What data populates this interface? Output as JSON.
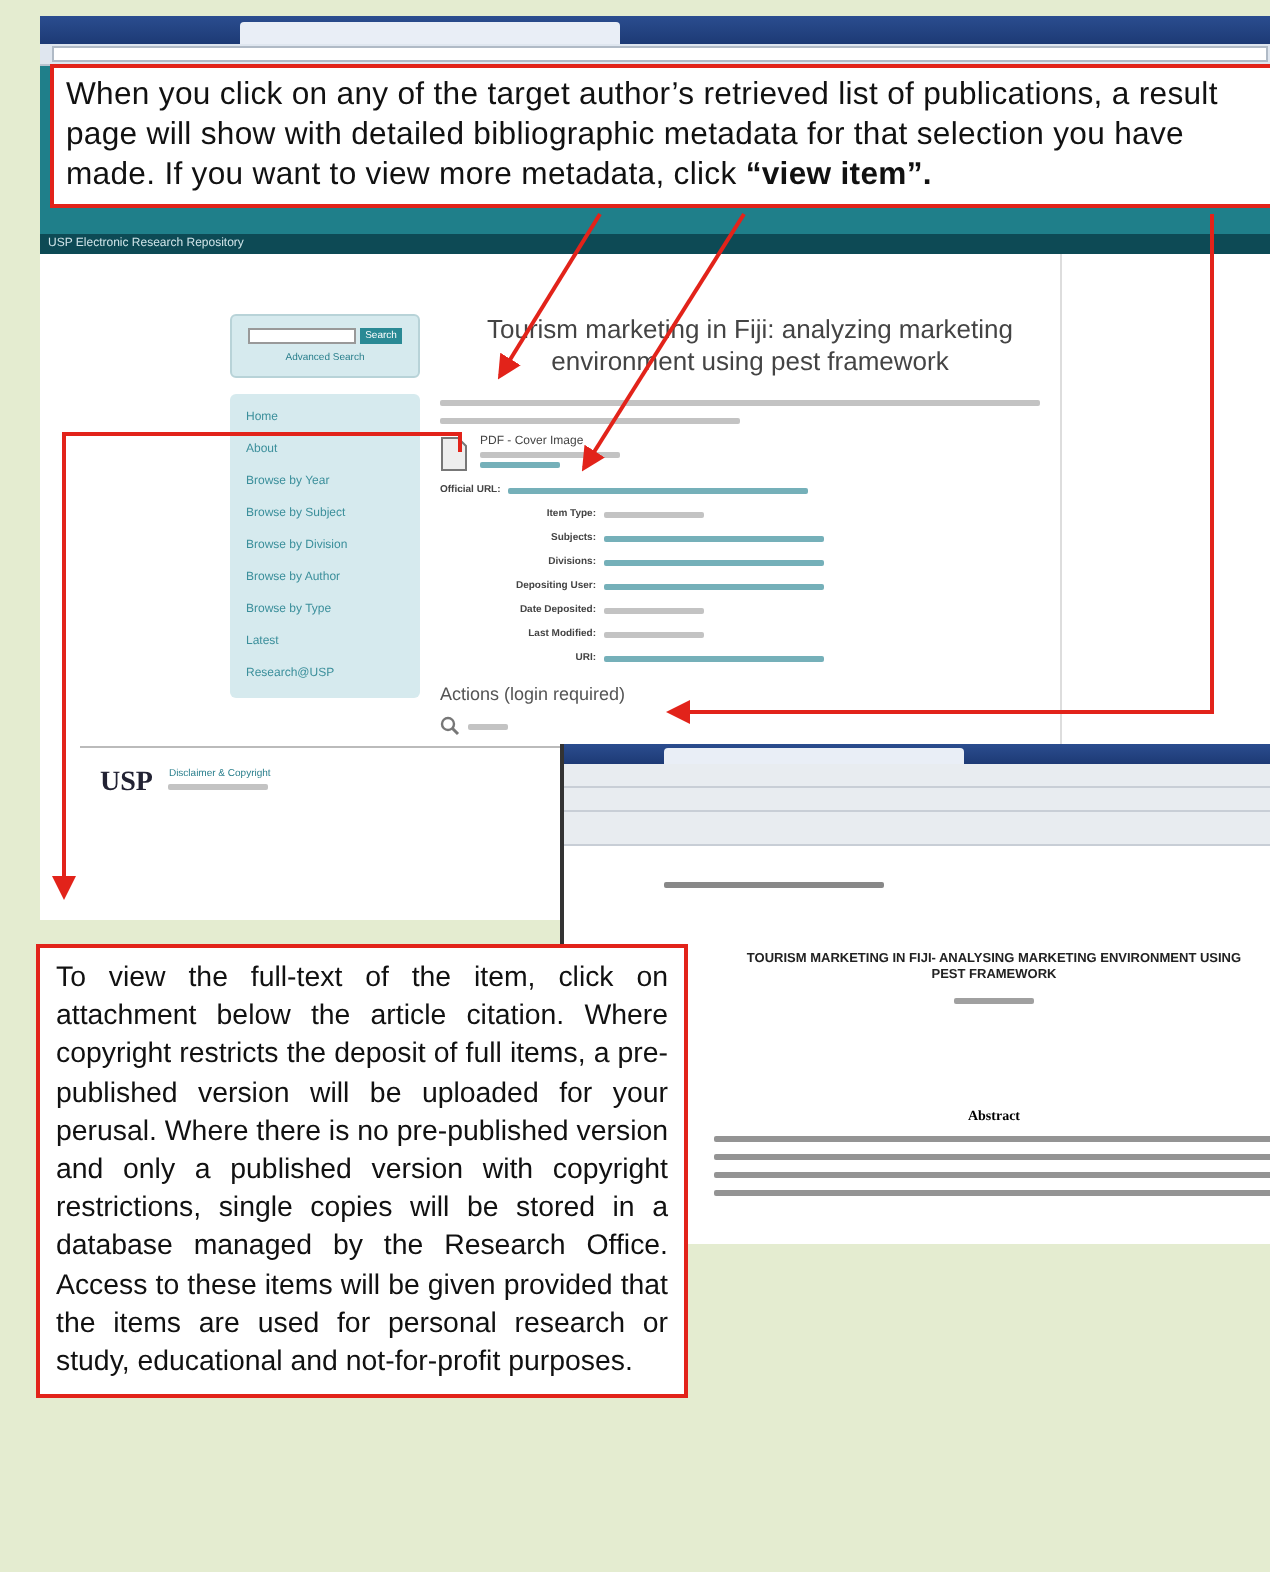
{
  "repository": {
    "header": "USP Electronic Research Repository",
    "search_button": "Search",
    "advanced_search": "Advanced Search",
    "nav": [
      {
        "label": "Home"
      },
      {
        "label": "About"
      },
      {
        "label": "Browse by Year"
      },
      {
        "label": "Browse by Subject"
      },
      {
        "label": "Browse by Division"
      },
      {
        "label": "Browse by Author"
      },
      {
        "label": "Browse by Type"
      },
      {
        "label": "Latest"
      },
      {
        "label": "Research@USP"
      }
    ],
    "title": "Tourism marketing in Fiji: analyzing marketing environment using pest framework",
    "attachment": "PDF - Cover Image",
    "official_url_label": "Official URL:",
    "fields": [
      {
        "label": "Item Type:",
        "kind": "text"
      },
      {
        "label": "Subjects:",
        "kind": "link"
      },
      {
        "label": "Divisions:",
        "kind": "link"
      },
      {
        "label": "Depositing User:",
        "kind": "link"
      },
      {
        "label": "Date Deposited:",
        "kind": "text"
      },
      {
        "label": "Last Modified:",
        "kind": "text"
      },
      {
        "label": "URI:",
        "kind": "link"
      }
    ],
    "actions_heading": "Actions (login required)",
    "footer": {
      "logo": "USP",
      "link": "Disclaimer & Copyright"
    }
  },
  "document": {
    "title": "TOURISM MARKETING IN FIJI- ANALYSING MARKETING ENVIRONMENT USING PEST FRAMEWORK",
    "abstract_heading": "Abstract"
  },
  "callouts": [
    {
      "text": "When you click on any of the target author’s retrieved list of publications, a result page will show with detailed bibliographic metadata for that selection you have made. If you want to view more metadata, click **“view item”.**"
    },
    {
      "text": "To view the full-text of the item, click on attachment below the article citation. Where copyright restricts the deposit of full items, a pre-published version will be uploaded for your perusal. Where there is no pre-published version and only a published version with copyright restrictions, single copies will be stored in a database managed by the Research Office. Access to these items will be given provided that the items are used for personal research or study, educational and not-for-profit purposes."
    }
  ]
}
